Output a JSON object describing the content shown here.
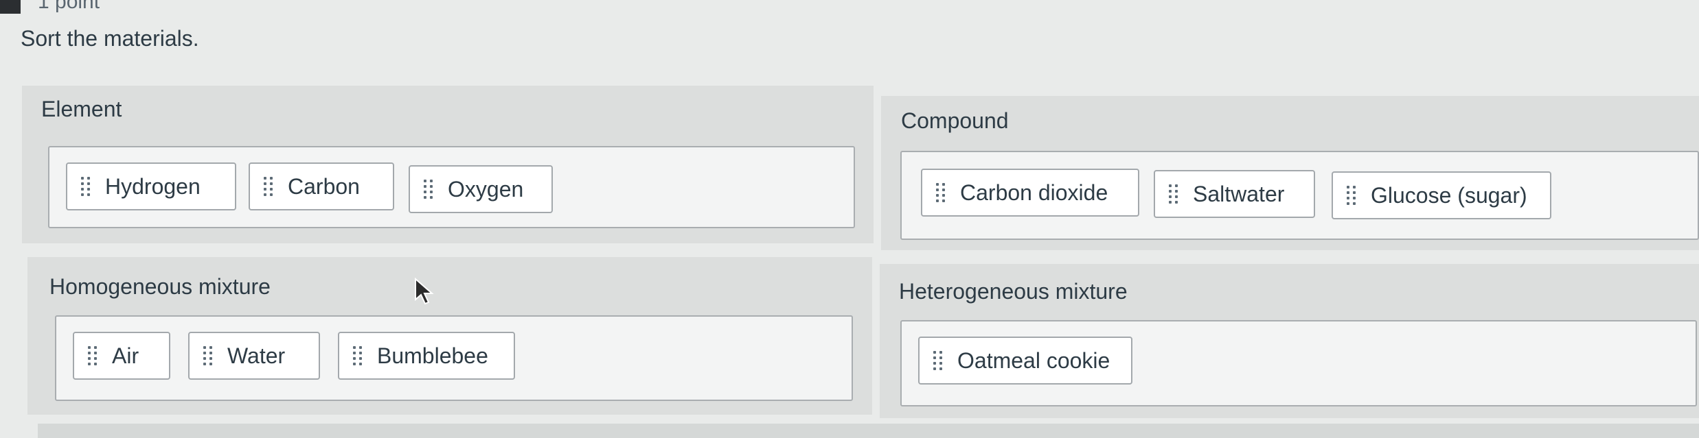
{
  "header": {
    "points": "1 point"
  },
  "question": {
    "prompt": "Sort the materials."
  },
  "zones": [
    {
      "title": "Element",
      "items": [
        "Hydrogen",
        "Carbon",
        "Oxygen"
      ]
    },
    {
      "title": "Compound",
      "items": [
        "Carbon dioxide",
        "Saltwater",
        "Glucose (sugar)"
      ]
    },
    {
      "title": "Homogeneous mixture",
      "items": [
        "Air",
        "Water",
        "Bumblebee"
      ]
    },
    {
      "title": "Heterogeneous mixture",
      "items": [
        "Oatmeal cookie"
      ]
    }
  ],
  "icons": {
    "drag_handle": "drag-grip-icon",
    "pointer": "mouse-pointer-icon"
  },
  "colors": {
    "chip_border": "#a3a8ac",
    "zone_bg": "#dcdedd",
    "text": "#2d3b45"
  }
}
